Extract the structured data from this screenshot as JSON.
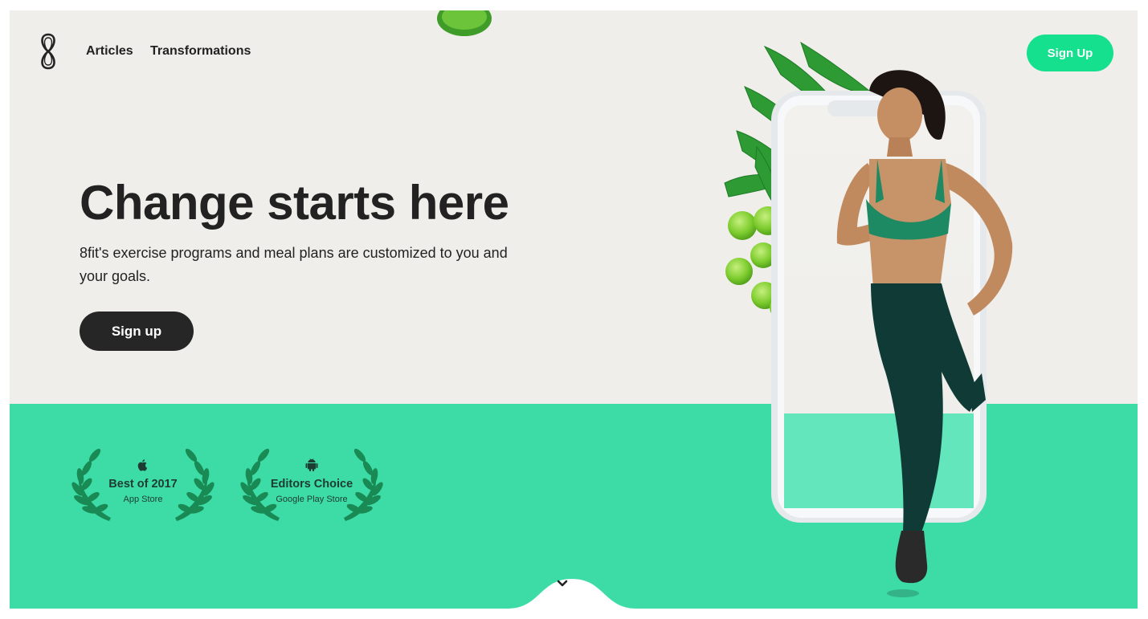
{
  "nav": {
    "logo_icon": "8fit-infinity-logo",
    "links": [
      {
        "label": "Articles"
      },
      {
        "label": "Transformations"
      }
    ],
    "signup_label": "Sign Up"
  },
  "hero": {
    "headline": "Change starts here",
    "subtext": "8fit's exercise programs and meal plans are customized to you and your goals.",
    "cta_label": "Sign up"
  },
  "awards": [
    {
      "icon": "apple-icon",
      "title": "Best of 2017",
      "subtitle": "App Store"
    },
    {
      "icon": "android-icon",
      "title": "Editors Choice",
      "subtitle": "Google Play Store"
    }
  ],
  "scroll_icon": "chevron-down-icon",
  "colors": {
    "hero_bg": "#efeeea",
    "band_green": "#3ddca6",
    "signup_green": "#14e08e",
    "dark_button": "#262626",
    "laurel_green": "#1a8a55"
  }
}
